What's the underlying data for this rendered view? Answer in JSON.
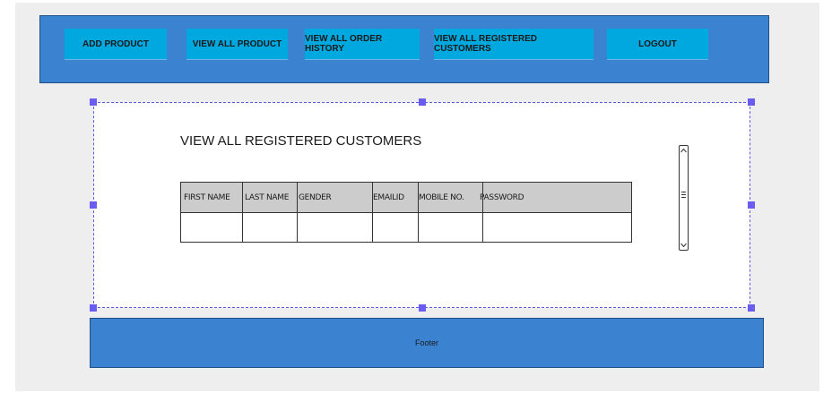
{
  "nav": {
    "items": [
      {
        "label": "ADD PRODUCT"
      },
      {
        "label": "VIEW ALL PRODUCT"
      },
      {
        "label": "VIEW ALL ORDER HISTORY"
      },
      {
        "label": "VIEW ALL REGISTERED CUSTOMERS"
      },
      {
        "label": "LOGOUT"
      }
    ]
  },
  "main": {
    "title": "VIEW ALL REGISTERED CUSTOMERS",
    "table": {
      "headers": [
        "FIRST NAME",
        "LAST NAME",
        "GENDER",
        "EMAILID",
        "MOBILE NO.",
        "PASSWORD"
      ],
      "rows": [
        [
          "",
          "",
          "",
          "",
          "",
          ""
        ]
      ]
    }
  },
  "scrollbar": {
    "up_glyph": "^",
    "down_glyph": "v"
  },
  "footer": {
    "label": "Footer"
  },
  "colors": {
    "header_bg": "#3b82d1",
    "nav_button": "#00a8e0",
    "table_header": "#cccccc",
    "selection_handle": "#6a5cf0"
  }
}
